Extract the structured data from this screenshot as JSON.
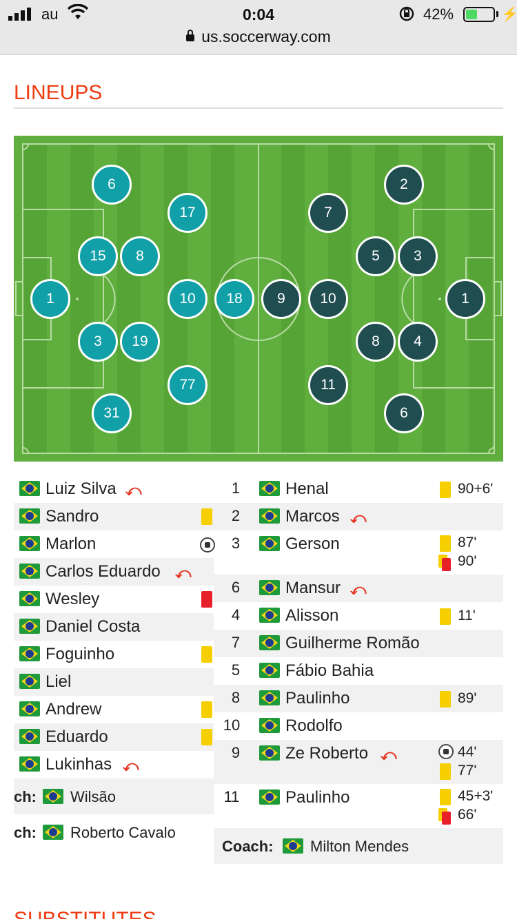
{
  "status_bar": {
    "carrier": "au",
    "time": "0:04",
    "battery_percent": "42%",
    "battery_level": 0.42,
    "icons": [
      "signal-bars-icon",
      "wifi-icon",
      "rotation-lock-icon",
      "battery-icon",
      "charging-bolt-icon"
    ]
  },
  "browser": {
    "url": "us.soccerway.com"
  },
  "section": {
    "title": "LINEUPS",
    "next_title": "SUBSTITUTES"
  },
  "colors": {
    "accent": "#ee3a0f",
    "home": "#11a0a8",
    "away": "#1f4d50",
    "pitch": "#5fae3e"
  },
  "formation": {
    "home": [
      "6",
      "17",
      "15",
      "8",
      "1",
      "10",
      "18",
      "3",
      "19",
      "77",
      "31"
    ],
    "away": [
      "2",
      "7",
      "5",
      "3",
      "9",
      "10",
      "1",
      "8",
      "4",
      "11",
      "6"
    ]
  },
  "home_team": {
    "players": [
      {
        "name": "Luiz Silva",
        "event": "sub"
      },
      {
        "name": "Sandro",
        "event": "yellow"
      },
      {
        "name": "Marlon",
        "event": "goal"
      },
      {
        "name": "Carlos Eduardo",
        "event": "sub"
      },
      {
        "name": "Wesley",
        "event": "red"
      },
      {
        "name": "Daniel Costa",
        "event": ""
      },
      {
        "name": "Foguinho",
        "event": "yellow"
      },
      {
        "name": "Liel",
        "event": ""
      },
      {
        "name": "Andrew",
        "event": "yellow"
      },
      {
        "name": "Eduardo",
        "event": "yellow"
      },
      {
        "name": "Lukinhas",
        "event": "sub"
      }
    ],
    "coach_label": "ch:",
    "coach": "Wilsão",
    "coach2_label": "ch:",
    "coach2": "Roberto Cavalo"
  },
  "away_team": {
    "players": [
      {
        "num": "1",
        "name": "Henal",
        "events": [
          {
            "type": "yellow",
            "time": "90+6'"
          }
        ]
      },
      {
        "num": "2",
        "name": "Marcos",
        "sub": true,
        "events": []
      },
      {
        "num": "3",
        "name": "Gerson",
        "events": [
          {
            "type": "yellow",
            "time": "87'"
          },
          {
            "type": "second-yellow",
            "time": "90'"
          }
        ]
      },
      {
        "num": "6",
        "name": "Mansur",
        "sub": true,
        "events": []
      },
      {
        "num": "4",
        "name": "Alisson",
        "events": [
          {
            "type": "yellow",
            "time": "11'"
          }
        ]
      },
      {
        "num": "7",
        "name": "Guilherme Romão",
        "events": []
      },
      {
        "num": "5",
        "name": "Fábio Bahia",
        "events": []
      },
      {
        "num": "8",
        "name": "Paulinho",
        "events": [
          {
            "type": "yellow",
            "time": "89'"
          }
        ]
      },
      {
        "num": "10",
        "name": "Rodolfo",
        "events": []
      },
      {
        "num": "9",
        "name": "Ze Roberto",
        "sub": true,
        "events": [
          {
            "type": "goal",
            "time": "44'"
          },
          {
            "type": "yellow",
            "time": "77'"
          }
        ]
      },
      {
        "num": "11",
        "name": "Paulinho",
        "events": [
          {
            "type": "yellow",
            "time": "45+3'"
          },
          {
            "type": "second-yellow",
            "time": "66'"
          }
        ]
      }
    ],
    "coach_label": "Coach:",
    "coach": "Milton Mendes"
  }
}
